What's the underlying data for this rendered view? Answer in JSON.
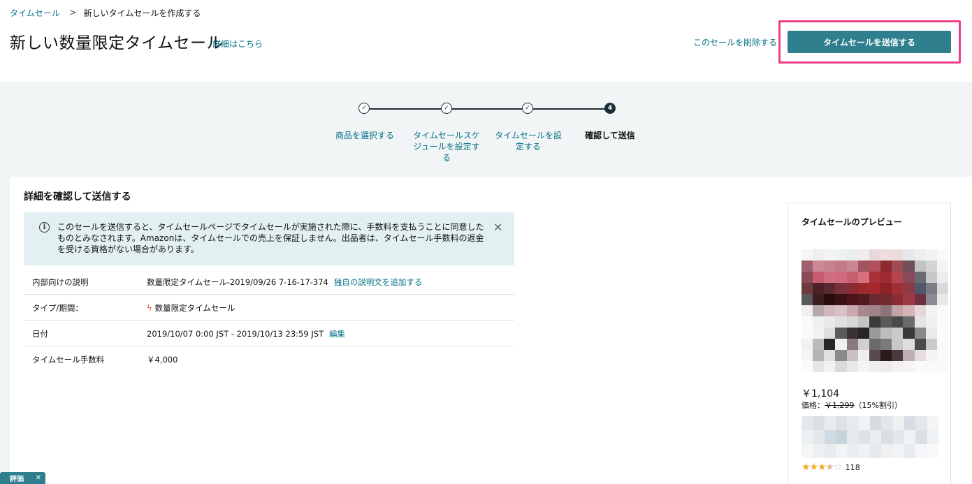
{
  "breadcrumb": {
    "parent": "タイムセール",
    "separator": ">",
    "current": "新しいタイムセールを作成する"
  },
  "header": {
    "title": "新しい数量限定タイムセール",
    "detail_link": "詳細はこちら",
    "delete_link": "このセールを削除する",
    "submit_button": "タイムセールを送信する"
  },
  "stepper": {
    "steps": [
      {
        "icon": "✓",
        "label": "商品を選択する"
      },
      {
        "icon": "✓",
        "label": "タイムセールスケジュールを設定する"
      },
      {
        "icon": "✓",
        "label": "タイムセールを設定する"
      },
      {
        "icon": "4",
        "label": "確認して送信"
      }
    ]
  },
  "main": {
    "title": "詳細を確認して送信する",
    "alert": {
      "icon": "i",
      "text": "このセールを送信すると、タイムセールページでタイムセールが実施された際に、手数料を支払うことに同意したものとみなされます。Amazonは、タイムセールでの売上を保証しません。出品者は、タイムセール手数料の返金を受ける資格がない場合があります。",
      "close": "✕"
    },
    "details": [
      {
        "label": "内部向けの説明",
        "value": "数量限定タイムセール-2019/09/26 7-16-17-374",
        "link": "独自の説明文を追加する"
      },
      {
        "label": "タイプ/期間：",
        "icon": "ϟ",
        "value": "数量限定タイムセール"
      },
      {
        "label": "日付",
        "value": "2019/10/07 0:00 JST - 2019/10/13 23:59 JST",
        "link": "編集"
      },
      {
        "label": "タイムセール手数料",
        "value": "￥4,000"
      }
    ]
  },
  "preview": {
    "title": "タイムセールのプレビュー",
    "price": "￥1,104",
    "price_label": "価格：",
    "original_price": "￥1,299",
    "discount": "（15%割引）",
    "rating_value": 3.5,
    "stars": "★★★",
    "star_half": "★",
    "star_empty": "☆",
    "review_count": "118"
  },
  "eval_tab": {
    "label": "評価",
    "close": "✕"
  }
}
